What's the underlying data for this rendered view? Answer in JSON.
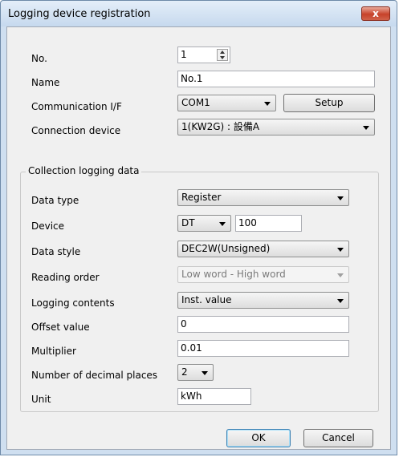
{
  "window": {
    "title": "Logging device registration",
    "close_label": "x"
  },
  "fields": {
    "no": {
      "label": "No.",
      "value": "1"
    },
    "name": {
      "label": "Name",
      "value": "No.1"
    },
    "comm_if": {
      "label": "Communication I/F",
      "value": "COM1",
      "setup_label": "Setup"
    },
    "connection_device": {
      "label": "Connection device",
      "value": "1(KW2G) : 設備A"
    }
  },
  "collection": {
    "title": "Collection logging data",
    "data_type": {
      "label": "Data type",
      "value": "Register"
    },
    "device": {
      "label": "Device",
      "prefix": "DT",
      "value": "100"
    },
    "data_style": {
      "label": "Data style",
      "value": "DEC2W(Unsigned)"
    },
    "reading_order": {
      "label": "Reading order",
      "value": "Low word - High word"
    },
    "logging_contents": {
      "label": "Logging contents",
      "value": "Inst. value"
    },
    "offset_value": {
      "label": "Offset value",
      "value": "0"
    },
    "multiplier": {
      "label": "Multiplier",
      "value": "0.01"
    },
    "decimal_places": {
      "label": "Number of decimal places",
      "value": "2"
    },
    "unit": {
      "label": "Unit",
      "value": "kWh"
    }
  },
  "buttons": {
    "ok": "OK",
    "cancel": "Cancel"
  }
}
